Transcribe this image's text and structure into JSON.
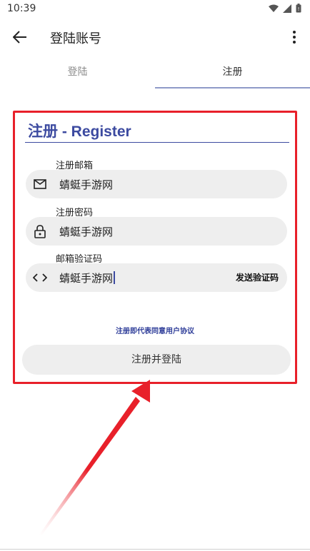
{
  "status": {
    "time": "10:39"
  },
  "app_bar": {
    "title": "登陆账号"
  },
  "tabs": [
    {
      "label": "登陆",
      "selected": false
    },
    {
      "label": "注册",
      "selected": true
    }
  ],
  "form": {
    "title": "注册 - Register",
    "email": {
      "label": "注册邮箱",
      "value": "蜻蜓手游网"
    },
    "password": {
      "label": "注册密码",
      "value": "蜻蜓手游网"
    },
    "code": {
      "label": "邮箱验证码",
      "value": "蜻蜓手游网",
      "send_label": "发送验证码"
    },
    "agreement": "注册即代表同意用户协议",
    "submit_label": "注册并登陆"
  },
  "colors": {
    "accent": "#3c4aa0",
    "annotation": "#e8202a"
  }
}
